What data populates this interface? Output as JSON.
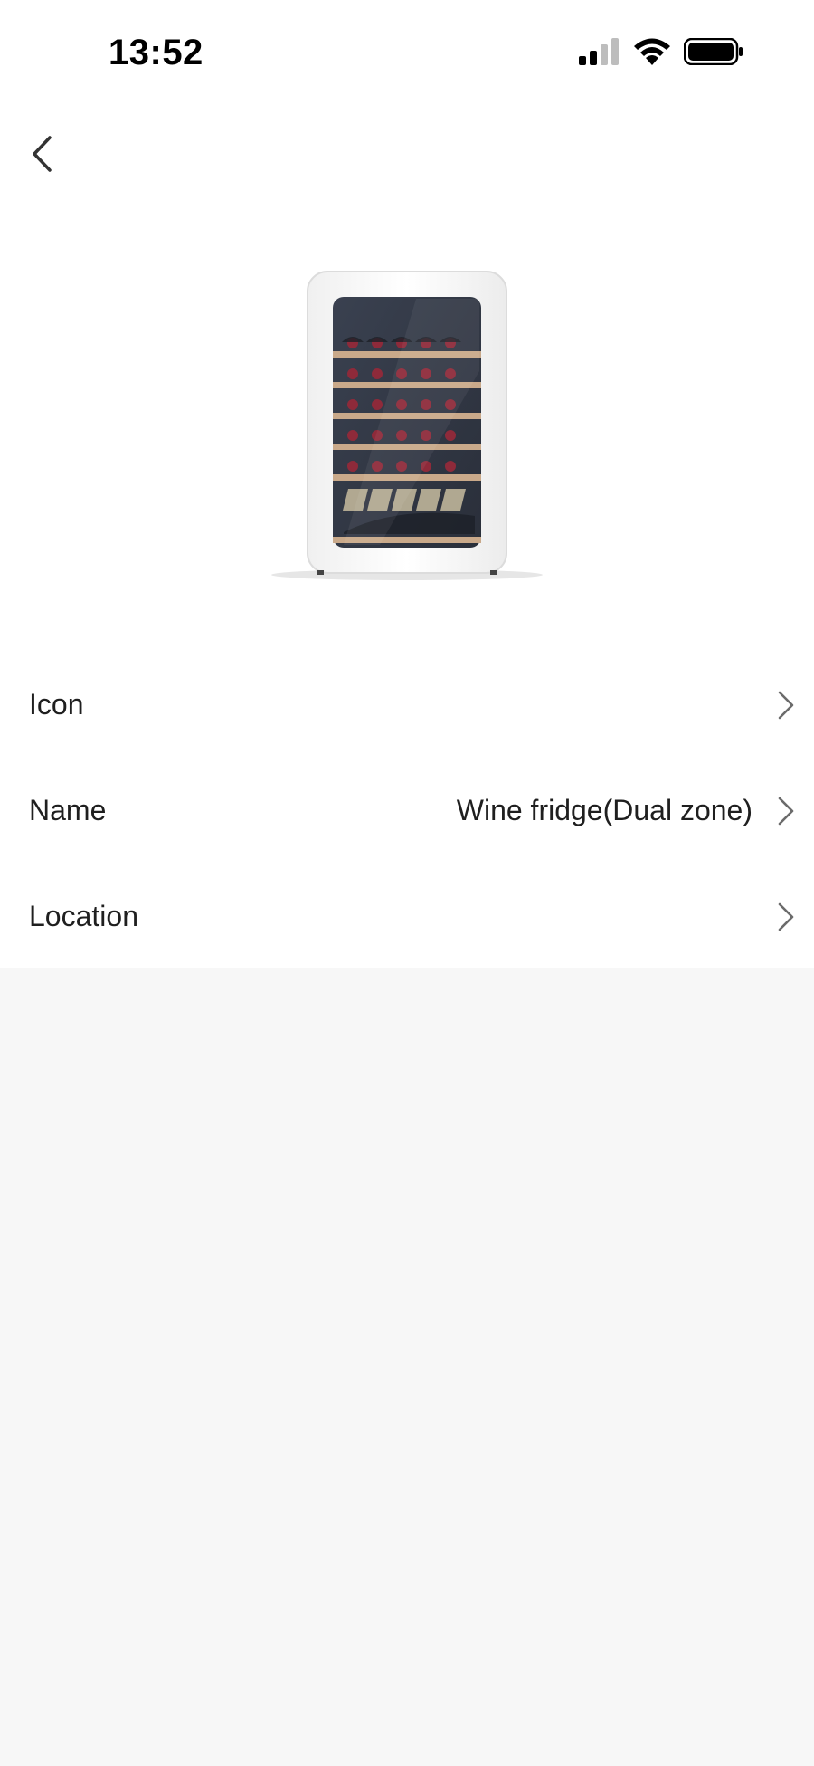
{
  "status_bar": {
    "time": "13:52",
    "icons": [
      "cellular-signal-icon",
      "wifi-icon",
      "battery-icon"
    ]
  },
  "nav": {
    "back_icon": "chevron-left-icon"
  },
  "device": {
    "image_name": "wine-fridge-image"
  },
  "settings": {
    "items": [
      {
        "label": "Icon",
        "value": ""
      },
      {
        "label": "Name",
        "value": "Wine fridge(Dual zone)"
      },
      {
        "label": "Location",
        "value": ""
      }
    ]
  },
  "colors": {
    "background": "#f7f7f7",
    "card": "#ffffff",
    "text": "#1f1f1f",
    "chevron": "#6b6b6b"
  }
}
